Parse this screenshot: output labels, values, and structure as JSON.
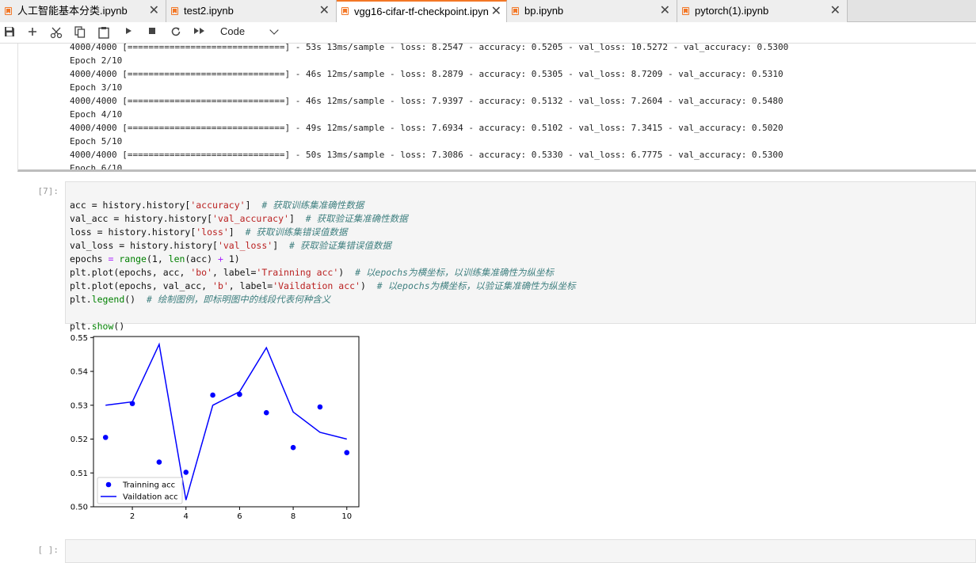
{
  "tabs": [
    {
      "label": "人工智能基本分类.ipynb"
    },
    {
      "label": "test2.ipynb"
    },
    {
      "label": "vgg16-cifar-tf-checkpoint.ipynb"
    },
    {
      "label": "bp.ipynb"
    },
    {
      "label": "pytorch(1).ipynb"
    }
  ],
  "tab_close_glyph": "✕",
  "toolbar": {
    "buttons": [
      "save-icon",
      "add-icon",
      "cut-icon",
      "copy-icon",
      "paste-icon",
      "run-icon",
      "stop-icon",
      "restart-icon",
      "fast-forward-icon"
    ],
    "cell_type": "Code"
  },
  "output_lines": [
    "4000/4000 [==============================] - 53s 13ms/sample - loss: 8.2547 - accuracy: 0.5205 - val_loss: 10.5272 - val_accuracy: 0.5300",
    "Epoch 2/10",
    "4000/4000 [==============================] - 46s 12ms/sample - loss: 8.2879 - accuracy: 0.5305 - val_loss: 8.7209 - val_accuracy: 0.5310",
    "Epoch 3/10",
    "4000/4000 [==============================] - 46s 12ms/sample - loss: 7.9397 - accuracy: 0.5132 - val_loss: 7.2604 - val_accuracy: 0.5480",
    "Epoch 4/10",
    "4000/4000 [==============================] - 49s 12ms/sample - loss: 7.6934 - accuracy: 0.5102 - val_loss: 7.3415 - val_accuracy: 0.5020",
    "Epoch 5/10",
    "4000/4000 [==============================] - 50s 13ms/sample - loss: 7.3086 - accuracy: 0.5330 - val_loss: 6.7775 - val_accuracy: 0.5300",
    "Epoch 6/10"
  ],
  "cell": {
    "prompt": "[7]:",
    "code_lines": [
      "acc = history.history['accuracy']  # 获取训练集准确性数据",
      "val_acc = history.history['val_accuracy']  # 获取验证集准确性数据",
      "loss = history.history['loss']  # 获取训练集错误值数据",
      "val_loss = history.history['val_loss']  # 获取验证集错误值数据",
      "epochs = range(1, len(acc) + 1)",
      "plt.plot(epochs, acc, 'bo', label='Trainning acc')  # 以epochs为横坐标，以训练集准确性为纵坐标",
      "plt.plot(epochs, val_acc, 'b', label='Vaildation acc')  # 以epochs为横坐标，以验证集准确性为纵坐标",
      "plt.legend()  # 绘制图例，即标明图中的线段代表何种含义",
      "",
      "plt.show()"
    ]
  },
  "empty_prompt": "[ ]:",
  "chart_data": {
    "type": "line",
    "x": [
      1,
      2,
      3,
      4,
      5,
      6,
      7,
      8,
      9,
      10
    ],
    "series": [
      {
        "name": "Trainning acc",
        "style": "points",
        "color": "#0000ff",
        "values": [
          0.5205,
          0.5305,
          0.5132,
          0.5102,
          0.533,
          0.5332,
          0.5278,
          0.5175,
          0.5295,
          0.516
        ]
      },
      {
        "name": "Vaildation acc",
        "style": "line",
        "color": "#0000ff",
        "values": [
          0.53,
          0.531,
          0.548,
          0.502,
          0.53,
          0.534,
          0.547,
          0.528,
          0.522,
          0.52
        ]
      }
    ],
    "xticks": [
      "2",
      "4",
      "6",
      "8",
      "10"
    ],
    "yticks": [
      "0.50",
      "0.51",
      "0.52",
      "0.53",
      "0.54",
      "0.55"
    ],
    "xlim": [
      0.55,
      10.45
    ],
    "ylim": [
      0.5,
      0.5503
    ],
    "legend": "lower-left"
  }
}
